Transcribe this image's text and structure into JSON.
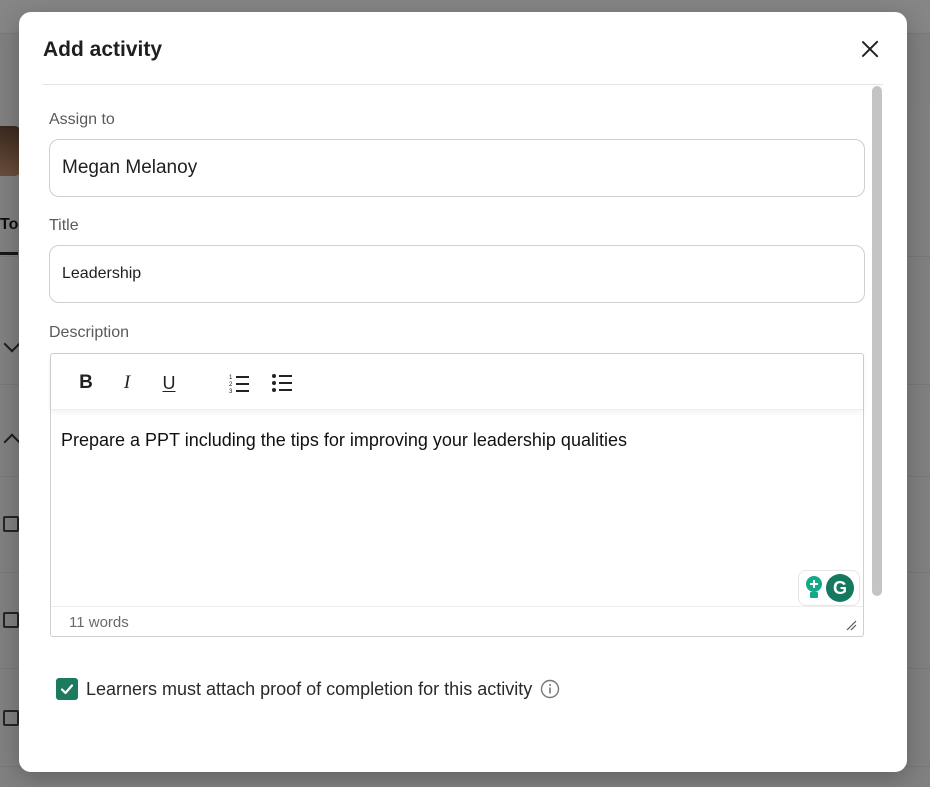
{
  "modal": {
    "title": "Add activity"
  },
  "form": {
    "assign_to": {
      "label": "Assign to",
      "value": "Megan Melanoy"
    },
    "title": {
      "label": "Title",
      "value": "Leadership"
    },
    "description": {
      "label": "Description",
      "content": "Prepare a PPT including the tips for improving your leadership qualities",
      "word_count": "11 words",
      "toolbar": {
        "bold": "B",
        "italic": "I",
        "underline": "U"
      }
    },
    "proof_checkbox": {
      "label": "Learners must attach proof of completion for this activity",
      "checked": true
    }
  },
  "background": {
    "tab_fragment": "To-"
  },
  "icons": {
    "close": "close-icon",
    "ordered_list": "ordered-list-icon",
    "bullet_list": "bullet-list-icon",
    "info": "info-icon",
    "grammarly": "grammarly-icon",
    "grammarly_letter": "G"
  },
  "colors": {
    "accent": "#1e7a5f",
    "grammarly": "#15795f"
  }
}
